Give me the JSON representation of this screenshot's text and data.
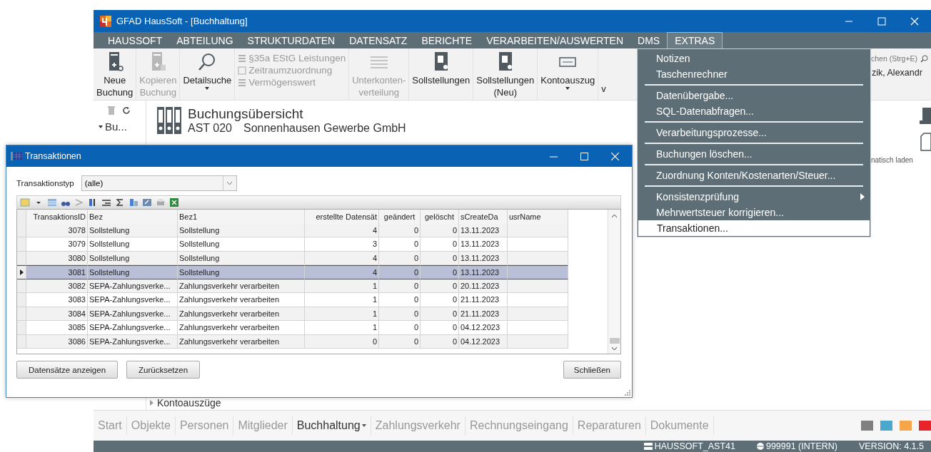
{
  "window": {
    "title": "GFAD HausSoft - [Buchhaltung]"
  },
  "menu_bar": [
    {
      "label": "HAUSSOFT",
      "selected": false
    },
    {
      "label": "ABTEILUNG",
      "selected": false
    },
    {
      "label": "STRUKTURDATEN",
      "selected": false
    },
    {
      "label": "DATENSATZ",
      "selected": false
    },
    {
      "label": "BERICHTE",
      "selected": false
    },
    {
      "label": "VERARBEITEN/AUSWERTEN",
      "selected": false
    },
    {
      "label": "DMS",
      "selected": false
    },
    {
      "label": "EXTRAS",
      "selected": true
    }
  ],
  "ribbon": [
    {
      "kind": "big",
      "lines": [
        "Neue",
        "Buchung"
      ],
      "disabled": false,
      "dropdown": false
    },
    {
      "kind": "big",
      "lines": [
        "Kopieren",
        "Buchung"
      ],
      "disabled": true,
      "dropdown": false
    },
    {
      "kind": "big",
      "lines": [
        "Detailsuche"
      ],
      "disabled": false,
      "dropdown": true
    },
    {
      "kind": "stack",
      "items": [
        {
          "label": "§35a EStG Leistungen",
          "disabled": true
        },
        {
          "label": "Zeitraumzuordnung",
          "disabled": true
        },
        {
          "label": "Vermögenswert",
          "disabled": true
        }
      ]
    },
    {
      "kind": "big",
      "lines": [
        "Unterkonten-",
        "verteilung"
      ],
      "disabled": true,
      "dropdown": false
    },
    {
      "kind": "big",
      "lines": [
        "Sollstellungen"
      ],
      "disabled": false,
      "dropdown": false
    },
    {
      "kind": "big",
      "lines": [
        "Sollstellungen",
        "(Neu)"
      ],
      "disabled": false,
      "dropdown": false
    },
    {
      "kind": "big",
      "lines": [
        "Kontoauszug"
      ],
      "disabled": false,
      "dropdown": true
    },
    {
      "kind": "cut",
      "lines": [
        "v"
      ],
      "disabled": false,
      "dropdown": false
    }
  ],
  "search": {
    "placeholder": "chen (Strg+E)"
  },
  "user": "zik, Alexandr",
  "side_panel": {
    "label": "Bu..."
  },
  "header": {
    "title": "Buchungsübersicht",
    "account": "AST 020",
    "company": "Sonnenhausen Gewerbe GmbH"
  },
  "right_panel": {
    "text": "natisch laden"
  },
  "section": {
    "label": "Kontoauszüge",
    "expanded": false
  },
  "bottom_tabs": [
    {
      "label": "Start",
      "selected": false,
      "dropdown": false
    },
    {
      "label": "Objekte",
      "selected": false,
      "dropdown": false
    },
    {
      "label": "Personen",
      "selected": false,
      "dropdown": false
    },
    {
      "label": "Mitglieder",
      "selected": false,
      "dropdown": false
    },
    {
      "label": "Buchhaltung",
      "selected": true,
      "dropdown": true
    },
    {
      "label": "Zahlungsverkehr",
      "selected": false,
      "dropdown": false
    },
    {
      "label": "Rechnungseingang",
      "selected": false,
      "dropdown": false
    },
    {
      "label": "Reparaturen",
      "selected": false,
      "dropdown": false
    },
    {
      "label": "Dokumente",
      "selected": false,
      "dropdown": false
    }
  ],
  "color_swatches": [
    {
      "color": "#808080"
    },
    {
      "color": "#4aa8cc"
    },
    {
      "color": "#f5a54a"
    },
    {
      "color": "#e8232a"
    }
  ],
  "status_bar": [
    {
      "kind": "server",
      "text": "HAUSSOFT_AST41"
    },
    {
      "kind": "client",
      "text": "999991 (INTERN)"
    },
    {
      "kind": "version",
      "text": "VERSION: 4.1.5"
    }
  ],
  "extras_menu": [
    {
      "kind": "item",
      "label": "Notizen",
      "selected": false
    },
    {
      "kind": "item",
      "label": "Taschenrechner",
      "selected": false
    },
    {
      "kind": "separator"
    },
    {
      "kind": "item",
      "label": "Datenübergabe...",
      "selected": false
    },
    {
      "kind": "item",
      "label": "SQL-Datenabfragen...",
      "selected": false
    },
    {
      "kind": "separator"
    },
    {
      "kind": "item",
      "label": "Verarbeitungsprozesse...",
      "selected": false
    },
    {
      "kind": "separator"
    },
    {
      "kind": "item",
      "label": "Buchungen löschen...",
      "selected": false
    },
    {
      "kind": "separator"
    },
    {
      "kind": "item",
      "label": "Zuordnung Konten/Kostenarten/Steuer...",
      "selected": false
    },
    {
      "kind": "separator"
    },
    {
      "kind": "submenu",
      "label": "Konsistenzprüfung",
      "selected": false
    },
    {
      "kind": "item",
      "label": "Mehrwertsteuer korrigieren...",
      "selected": false
    },
    {
      "kind": "item",
      "label": "Transaktionen...",
      "selected": true
    }
  ],
  "dialog": {
    "title": "Transaktionen",
    "filter": {
      "label": "Transaktionstyp",
      "value": "(alle)"
    },
    "columns": [
      "TransaktionsID",
      "Bez",
      "Bez1",
      "erstellte Datensät",
      "geändert",
      "gelöscht",
      "sCreateDa",
      "usrName"
    ],
    "rows": [
      {
        "cells": [
          "3078",
          "Sollstellung",
          "Sollstellung",
          "4",
          "0",
          "0",
          "13.11.2023",
          ""
        ],
        "selected": false
      },
      {
        "cells": [
          "3079",
          "Sollstellung",
          "Sollstellung",
          "3",
          "0",
          "0",
          "13.11.2023",
          ""
        ],
        "selected": false
      },
      {
        "cells": [
          "3080",
          "Sollstellung",
          "Sollstellung",
          "4",
          "0",
          "0",
          "13.11.2023",
          ""
        ],
        "selected": false
      },
      {
        "cells": [
          "3081",
          "Sollstellung",
          "Sollstellung",
          "4",
          "0",
          "0",
          "13.11.2023",
          ""
        ],
        "selected": true
      },
      {
        "cells": [
          "3082",
          "SEPA-Zahlungsverke...",
          "Zahlungsverkehr verarbeiten",
          "1",
          "0",
          "0",
          "20.11.2023",
          ""
        ],
        "selected": false
      },
      {
        "cells": [
          "3083",
          "SEPA-Zahlungsverke...",
          "Zahlungsverkehr verarbeiten",
          "1",
          "0",
          "0",
          "21.11.2023",
          ""
        ],
        "selected": false
      },
      {
        "cells": [
          "3084",
          "SEPA-Zahlungsverke...",
          "Zahlungsverkehr verarbeiten",
          "1",
          "0",
          "0",
          "21.11.2023",
          ""
        ],
        "selected": false
      },
      {
        "cells": [
          "3085",
          "SEPA-Zahlungsverke...",
          "Zahlungsverkehr verarbeiten",
          "1",
          "0",
          "0",
          "04.12.2023",
          ""
        ],
        "selected": false
      },
      {
        "cells": [
          "3086",
          "SEPA-Zahlungsverke...",
          "Zahlungsverkehr verarbeiten",
          "0",
          "0",
          "0",
          "04.12.2023",
          ""
        ],
        "selected": false
      }
    ],
    "buttons": [
      "Datensätze anzeigen",
      "Zurücksetzen"
    ],
    "close_button": "Schließen"
  }
}
